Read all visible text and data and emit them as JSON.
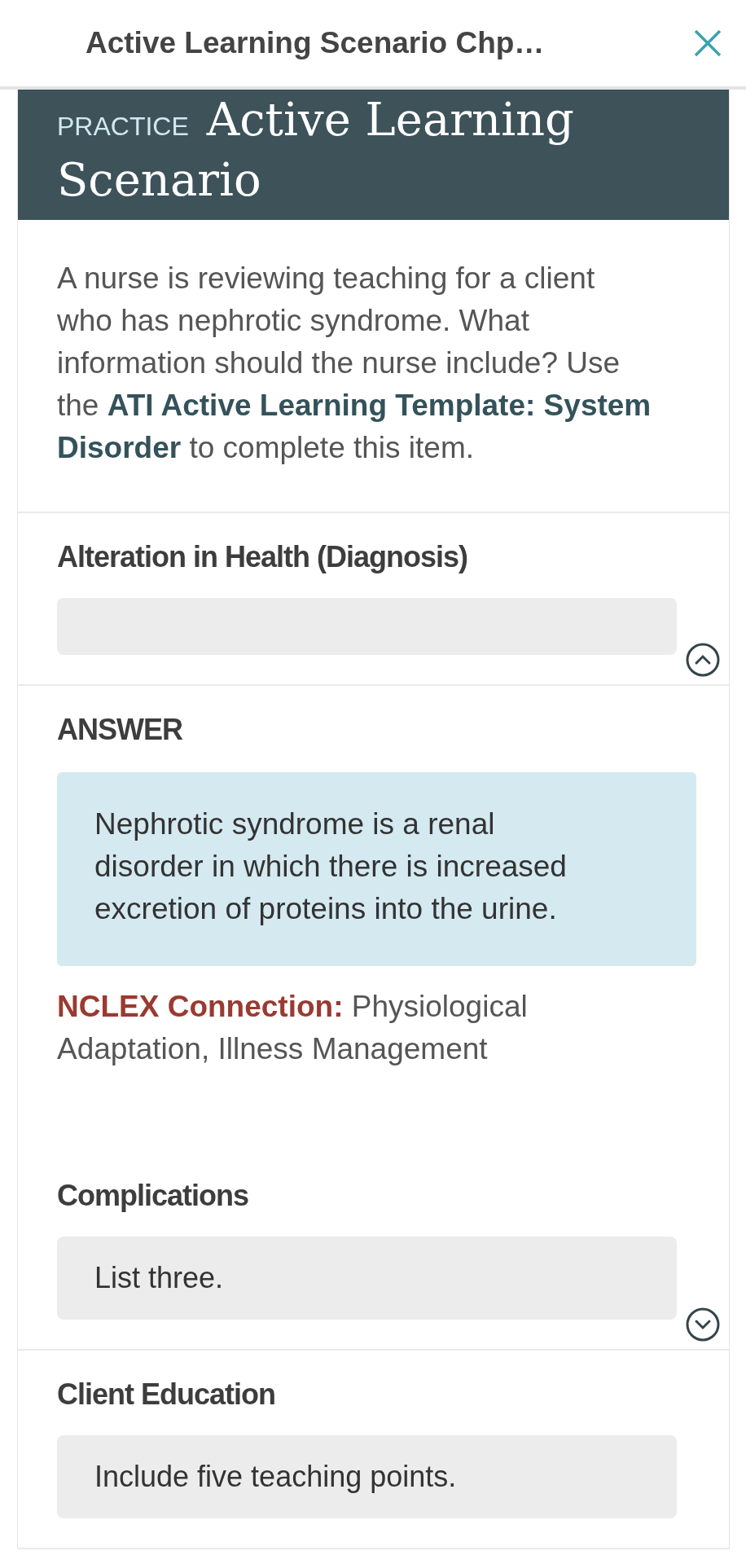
{
  "header": {
    "title": "Active Learning Scenario Chp…"
  },
  "banner": {
    "label": "PRACTICE",
    "title_lines": [
      "Active Learning",
      "Scenario"
    ]
  },
  "question": "A nurse is reviewing teaching for a client who has nephrotic syndrome. What information should the nurse include? Use the **ATI Active Learning Template: System Disorder** to complete this item.",
  "sections": [
    {
      "heading": "Alteration in Health (Diagnosis)",
      "expanded": true,
      "answer": {
        "heading": "ANSWER",
        "text": "Nephrotic syndrome is a renal disorder in which there is increased excretion of proteins into the urine.",
        "nclex": "**NCLEX Connection:** Physiological Adaptation, Illness Management"
      }
    },
    {
      "heading": "Complications",
      "placeholder": "List three.",
      "expanded": false
    },
    {
      "heading": "Client Education",
      "placeholder": "Include five teaching points."
    }
  ]
}
